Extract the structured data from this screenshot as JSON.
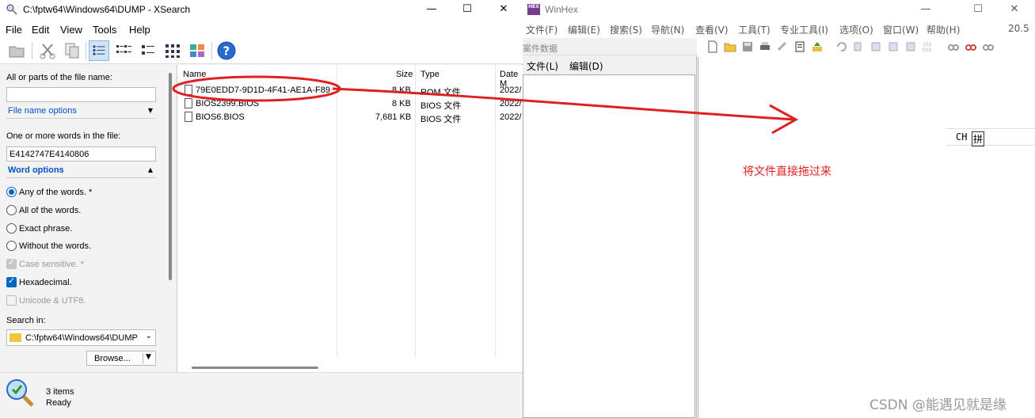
{
  "winhex": {
    "title": "WinHex",
    "version": "20.5",
    "menu": [
      "文件(F)",
      "编辑(E)",
      "搜索(S)",
      "导航(N)",
      "查看(V)",
      "工具(T)",
      "专业工具(I)",
      "选项(O)",
      "窗口(W)",
      "帮助(H)"
    ],
    "case_panel": {
      "title": "案件数据",
      "menu": [
        "文件(L)",
        "编辑(D)"
      ]
    },
    "ime": {
      "lang": "CH",
      "mode": "拼"
    },
    "annotation": "将文件直接拖过来",
    "watermark": "CSDN @能遇见就是缘"
  },
  "xsearch": {
    "title": "C:\\fptw64\\Windows64\\DUMP - XSearch",
    "menu": [
      "File",
      "Edit",
      "View",
      "Tools",
      "Help"
    ],
    "filename_label": "All or parts of the file name:",
    "filename_value": "",
    "filename_options": "File name options",
    "words_label": "One or more words in the file:",
    "words_value": "E4142747E4140806",
    "word_options": "Word options",
    "radios": [
      {
        "label": "Any of the words. *",
        "checked": true
      },
      {
        "label": "All of the words.",
        "checked": false
      },
      {
        "label": "Exact phrase.",
        "checked": false
      },
      {
        "label": "Without the words.",
        "checked": false
      }
    ],
    "checks": [
      {
        "label": "Case sensitive. *",
        "checked": true,
        "disabled": true
      },
      {
        "label": "Hexadecimal.",
        "checked": true,
        "disabled": false
      },
      {
        "label": "Unicode & UTF8.",
        "checked": false,
        "disabled": true
      }
    ],
    "search_in_label": "Search in:",
    "search_in_value": "C:\\fptw64\\Windows64\\DUMP",
    "browse_label": "Browse...",
    "columns": [
      "Name",
      "Size",
      "Type",
      "Date M"
    ],
    "files": [
      {
        "name": "79E0EDD7-9D1D-4F41-AE1A-F89",
        "size": "8 KB",
        "type": "ROM 文件",
        "date": "2022/"
      },
      {
        "name": "BIOS2399.BIOS",
        "size": "8 KB",
        "type": "BIOS 文件",
        "date": "2022/"
      },
      {
        "name": "BIOS6.BIOS",
        "size": "7,681 KB",
        "type": "BIOS 文件",
        "date": "2022/"
      }
    ],
    "status_count": "3 items",
    "status_state": "Ready"
  },
  "colors": {
    "accent": "#0067c0",
    "annotation": "#e02020",
    "link": "#0050c8"
  }
}
